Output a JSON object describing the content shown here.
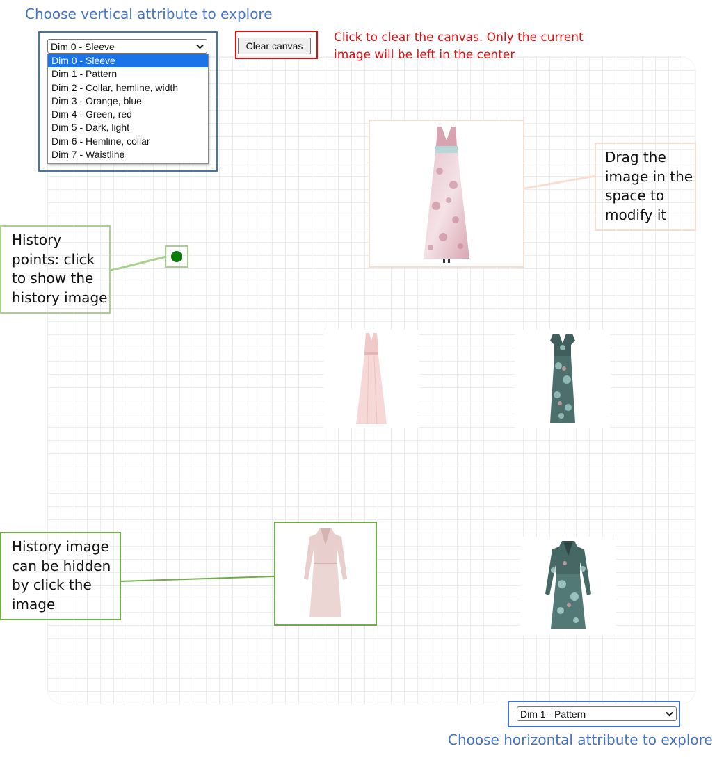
{
  "captions": {
    "vertical": "Choose vertical attribute to explore",
    "horizontal": "Choose horizontal attribute to explore",
    "clear_hint_line1": "Click to clear the canvas. Only the current",
    "clear_hint_line2": "image will be left in the center"
  },
  "vertical_select": {
    "selected": "Dim 0 - Sleeve",
    "options": [
      "Dim 0 - Sleeve",
      "Dim 1 - Pattern",
      "Dim 2 - Collar, hemline, width",
      "Dim 3 - Orange, blue",
      "Dim 4 - Green, red",
      "Dim 5 - Dark, light",
      "Dim 6 - Hemline, collar",
      "Dim 7 - Waistline"
    ]
  },
  "horizontal_select": {
    "selected": "Dim 1 - Pattern"
  },
  "toolbar": {
    "clear_label": "Clear canvas"
  },
  "callouts": {
    "drag": [
      "Drag the",
      "image in the",
      "space to",
      "modify it"
    ],
    "history_points": [
      "History",
      "points: click",
      "to show the",
      "history image"
    ],
    "history_image": [
      "History image",
      "can be hidden",
      "by click the",
      "image"
    ]
  },
  "colors": {
    "blue_caption": "#4472c4",
    "red_caption": "#e01010",
    "current_image_border": "#f8ddd0",
    "history_point_border": "#a9d18e",
    "history_point": "#0a7d0a",
    "history_image_border": "#70ad47",
    "selected_option": "#1a73e8"
  },
  "icons": {
    "dropdown": "chevron-down-icon"
  }
}
